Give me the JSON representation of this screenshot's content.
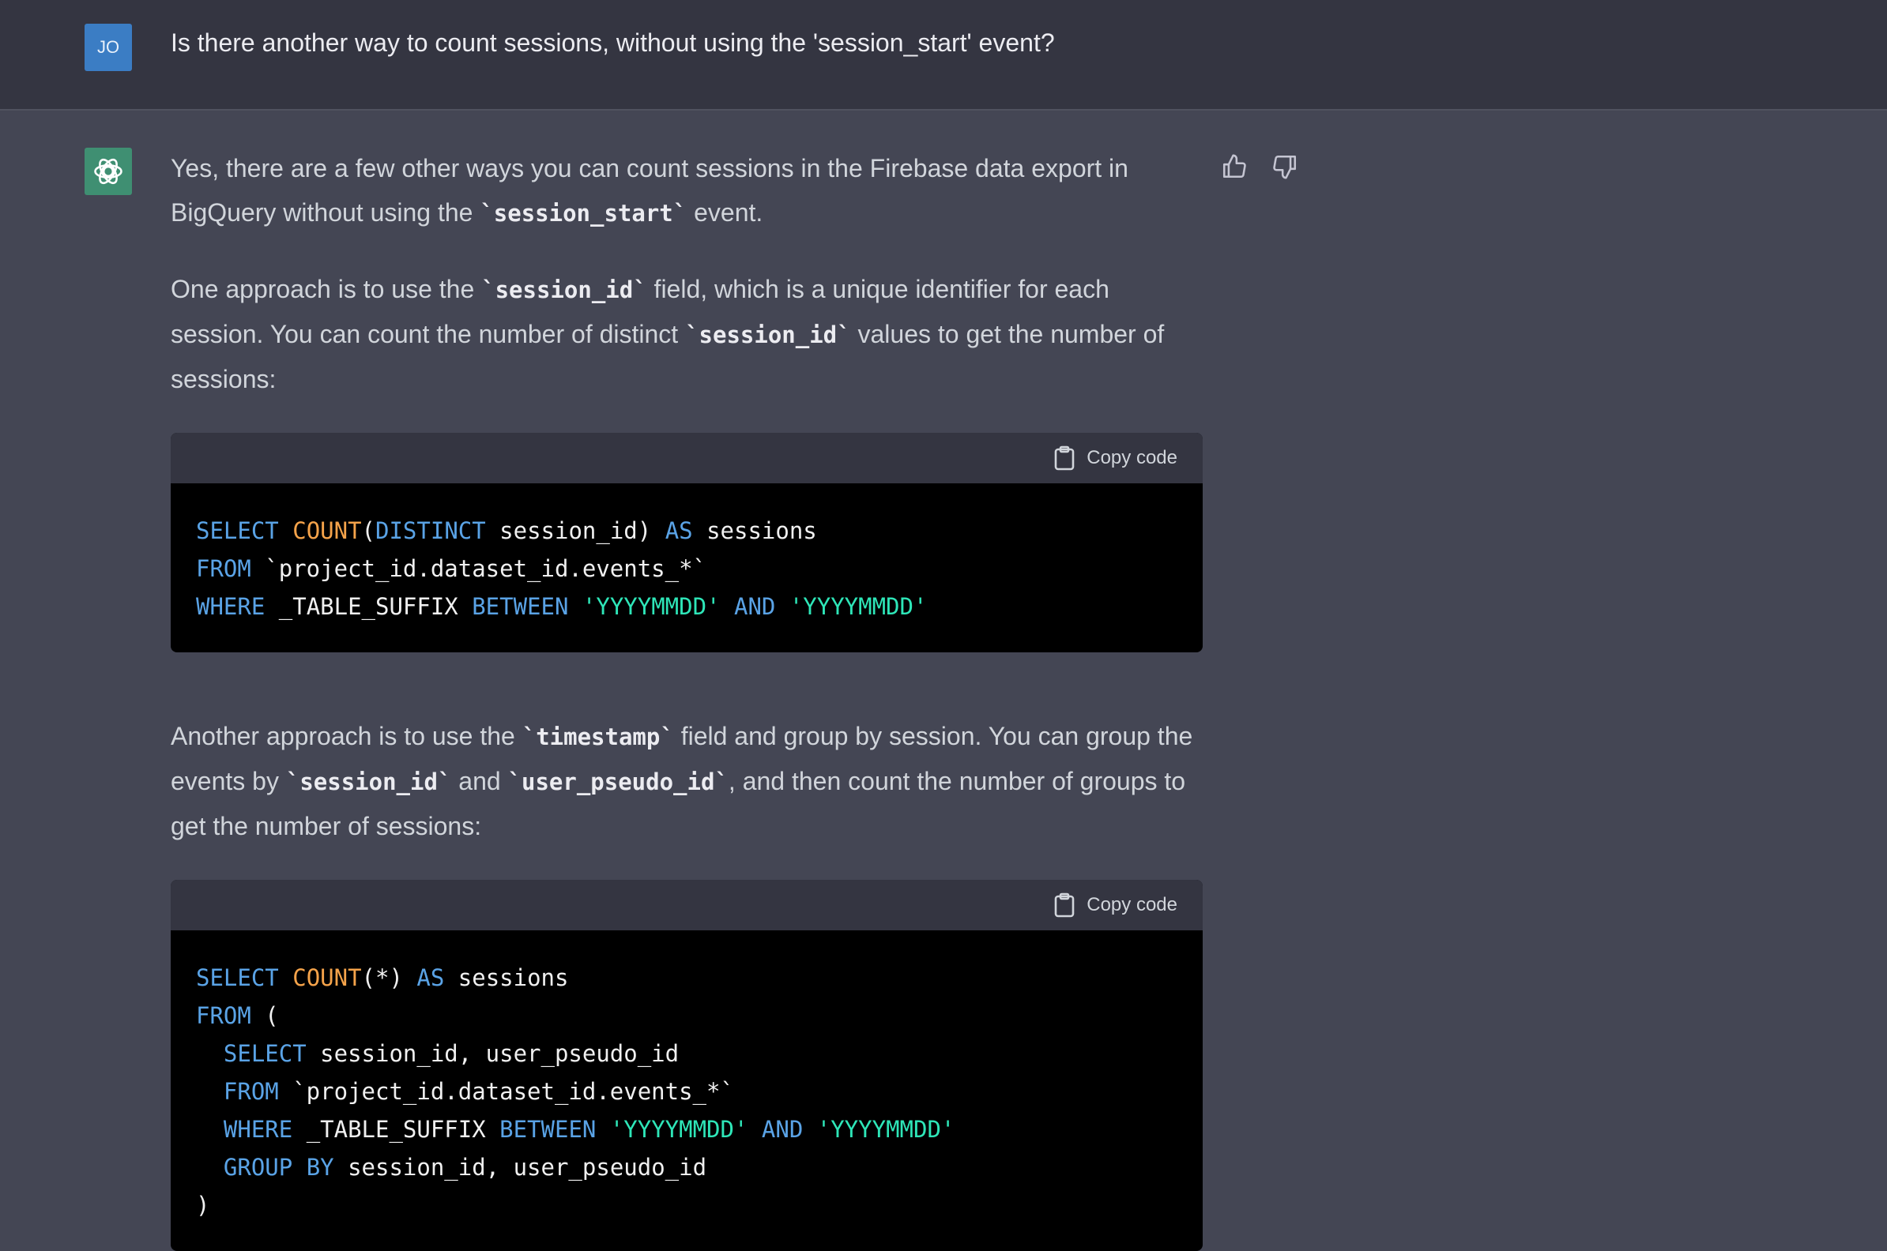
{
  "user": {
    "avatar_initials": "JO",
    "message": "Is there another way to count sessions, without using the 'session_start' event?"
  },
  "assistant": {
    "para1": [
      "Yes, there are a few other ways you can count sessions in the Firebase data export in BigQuery without using the ",
      "`session_start`",
      " event."
    ],
    "para2": [
      "One approach is to use the ",
      "`session_id`",
      " field, which is a unique identifier for each session. You can count the number of distinct ",
      "`session_id`",
      " values to get the number of sessions:"
    ],
    "para3": [
      "Another approach is to use the ",
      "`timestamp`",
      " field and group by session. You can group the events by ",
      "`session_id`",
      " and ",
      "`user_pseudo_id`",
      ", and then count the number of groups to get the number of sessions:"
    ],
    "copy_label": "Copy code",
    "code1": [
      [
        "SELECT",
        " ",
        "COUNT",
        "(",
        "DISTINCT",
        " session_id) ",
        "AS",
        " sessions"
      ],
      [
        "FROM",
        " `project_id.dataset_id.events_*`"
      ],
      [
        "WHERE",
        " _TABLE_SUFFIX ",
        "BETWEEN",
        " ",
        "'YYYYMMDD'",
        " ",
        "AND",
        " ",
        "'YYYYMMDD'"
      ]
    ],
    "code2": [
      [
        "SELECT",
        " ",
        "COUNT",
        "(*) ",
        "AS",
        " sessions"
      ],
      [
        "FROM",
        " ("
      ],
      [
        "  ",
        "SELECT",
        " session_id, user_pseudo_id"
      ],
      [
        "  ",
        "FROM",
        " `project_id.dataset_id.events_*`"
      ],
      [
        "  ",
        "WHERE",
        " _TABLE_SUFFIX ",
        "BETWEEN",
        " ",
        "'YYYYMMDD'",
        " ",
        "AND",
        " ",
        "'YYYYMMDD'"
      ],
      [
        "  ",
        "GROUP",
        " ",
        "BY",
        " session_id, user_pseudo_id"
      ],
      [
        ")"
      ]
    ]
  },
  "icons": {
    "thumbs_up": "thumbs-up-icon",
    "thumbs_down": "thumbs-down-icon",
    "clipboard": "clipboard-icon",
    "logo": "openai-logo-icon"
  }
}
